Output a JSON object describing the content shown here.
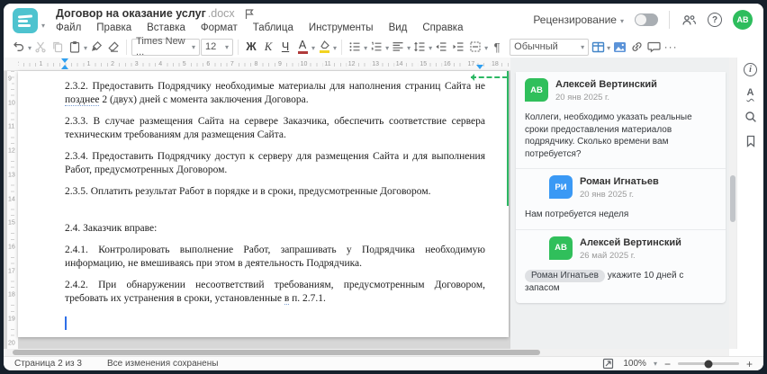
{
  "header": {
    "title": "Договор на оказание услуг",
    "title_ext": ".docx",
    "menus": [
      "Файл",
      "Правка",
      "Вставка",
      "Формат",
      "Таблица",
      "Инструменты",
      "Вид",
      "Справка"
    ],
    "review_label": "Рецензирование",
    "review_toggle_state": "off",
    "avatar_initials": "АВ",
    "colors": {
      "logo": "#4ec3cf",
      "avatar": "#2ebd5d"
    }
  },
  "toolbar": {
    "font_name": "Times New ...",
    "font_size": "12",
    "bold_letter": "Ж",
    "italic_letter": "К",
    "underline_letter": "Ч",
    "font_color_letter": "А",
    "style_name": "Обычный",
    "pilcrow": "¶",
    "more_label": "···"
  },
  "ruler": {
    "h_numbers_left": [
      "1",
      "2"
    ],
    "h_numbers_right": [
      "1",
      "2",
      "3",
      "4",
      "5",
      "6",
      "7",
      "8",
      "9",
      "10",
      "11",
      "12",
      "13",
      "14",
      "15",
      "16",
      "17",
      "18"
    ],
    "v_numbers": [
      "9",
      "10",
      "11",
      "12",
      "13",
      "14",
      "15",
      "16",
      "17",
      "18",
      "19",
      "20"
    ]
  },
  "document": {
    "paragraphs": [
      {
        "segments": [
          {
            "text": "2.3.2. Предоставить Подрядчику необходимые материалы для наполнения страниц Сайта не "
          },
          {
            "text": "позднее",
            "underline": true
          },
          {
            "text": " 2 (двух) дней с момента заключения Договора."
          }
        ]
      },
      {
        "segments": [
          {
            "text": "2.3.3. В случае размещения Сайта на сервере Заказчика, обеспечить соответствие сервера техническим требованиям для размещения Сайта."
          }
        ]
      },
      {
        "segments": [
          {
            "text": "2.3.4. Предоставить Подрядчику доступ к серверу для размещения Сайта и для выполнения Работ, предусмотренных Договором."
          }
        ]
      },
      {
        "segments": [
          {
            "text": "2.3.5. Оплатить результат Работ в порядке и в сроки, предусмотренные Договором."
          }
        ]
      },
      {
        "segments": [
          {
            "text": "2.4. Заказчик вправе:"
          }
        ],
        "gap_before": true
      },
      {
        "segments": [
          {
            "text": "2.4.1. Контролировать выполнение Работ, запрашивать у Подрядчика необходимую информацию, не вмешиваясь при этом в деятельность Подрядчика."
          }
        ]
      },
      {
        "segments": [
          {
            "text": "2.4.2. При обнаружении несоответствий требованиям, предусмотренным Договором, требовать их устранения в сроки, установленные "
          },
          {
            "text": "в",
            "underline": true
          },
          {
            "text": " п. 2.7.1."
          }
        ]
      }
    ]
  },
  "comments": {
    "accent_color": "#2cb763",
    "thread": [
      {
        "initials": "АВ",
        "color": "#30bf5b",
        "name": "Алексей Вертинский",
        "date": "20 янв 2025 г.",
        "text": "Коллеги, необходимо указать реальные сроки предоставления материалов подрядчику. Сколько времени вам потребуется?",
        "reply": false
      },
      {
        "initials": "РИ",
        "color": "#3a99f5",
        "name": "Роман Игнатьев",
        "date": "20 янв 2025 г.",
        "text": "Нам потребуется неделя",
        "reply": true
      },
      {
        "initials": "АВ",
        "color": "#30bf5b",
        "name": "Алексей Вертинский",
        "date": "26 май 2025 г.",
        "mention": "Роман Игнатьев",
        "text": "укажите 10 дней с запасом",
        "reply": true
      }
    ]
  },
  "statusbar": {
    "page_label": "Страница 2 из 3",
    "saved_label": "Все изменения сохранены",
    "zoom_value": "100%"
  }
}
